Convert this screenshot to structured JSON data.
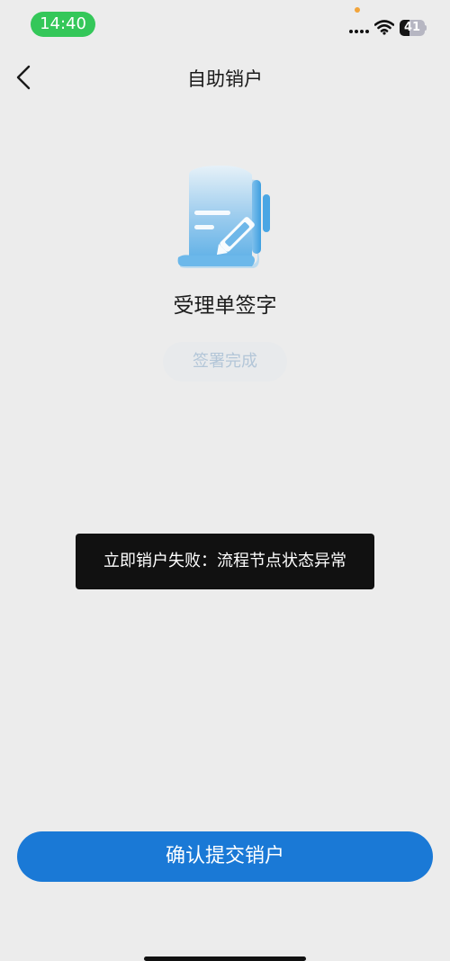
{
  "status_bar": {
    "time": "14:40",
    "battery": "41",
    "battery_level": 0.41
  },
  "nav": {
    "title": "自助销户",
    "back_icon": "chevron-left-icon"
  },
  "section": {
    "illustration_icon": "document-sign-icon",
    "title": "受理单签字",
    "status_button_label": "签署完成"
  },
  "toast": {
    "message": "立即销户失败：流程节点状态异常"
  },
  "footer": {
    "confirm_label": "确认提交销户"
  },
  "colors": {
    "accent": "#1a79d6",
    "background": "#ececec",
    "time_pill": "#34c759",
    "toast_bg": "#111111",
    "disabled_text": "#b3c6d8"
  }
}
